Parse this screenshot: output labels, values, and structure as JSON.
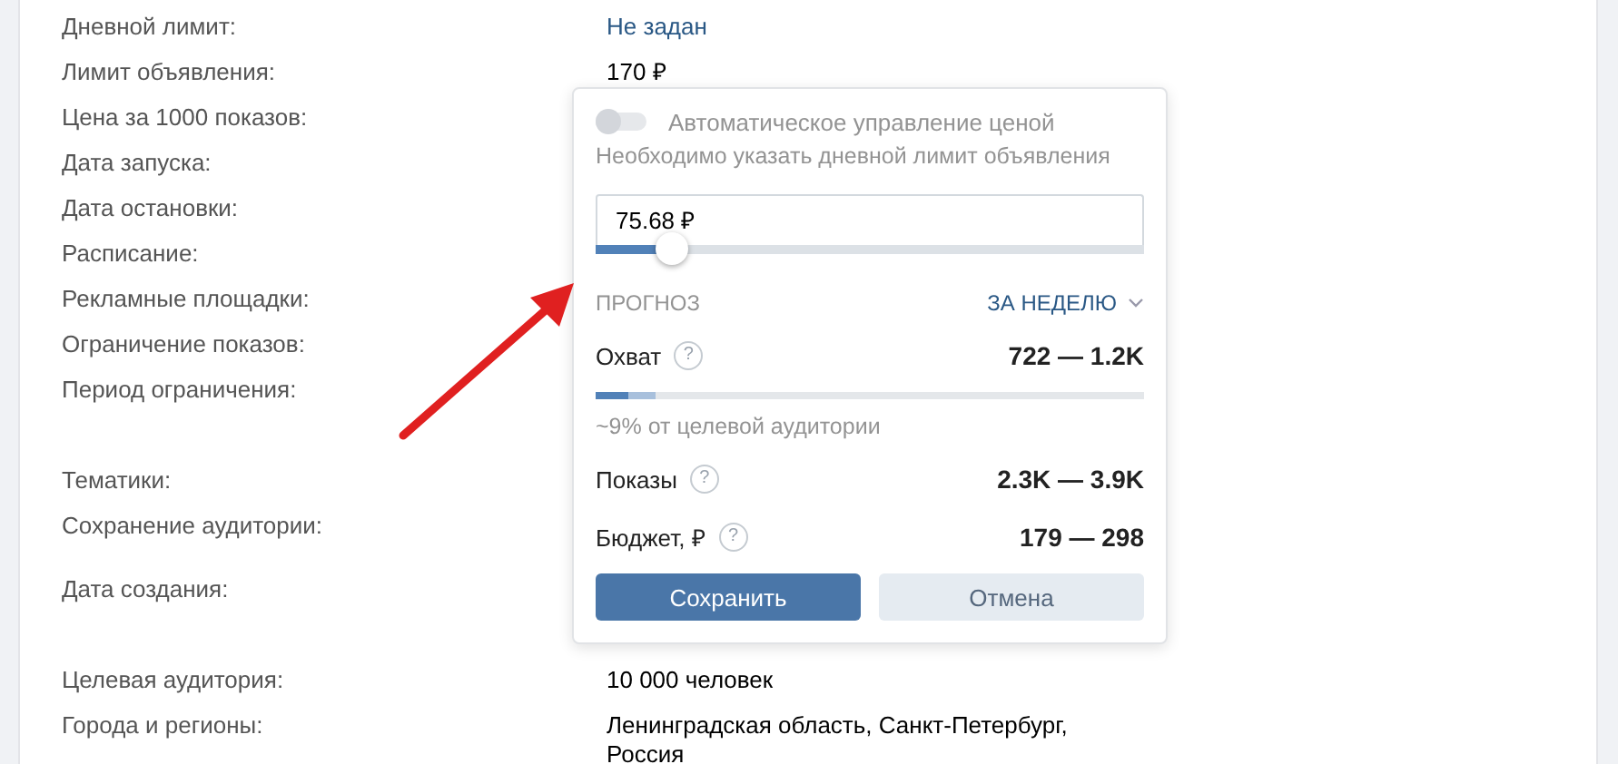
{
  "rows": [
    {
      "label": "Дневной лимит:",
      "value": "Не задан",
      "kind": "link"
    },
    {
      "label": "Лимит объявления:",
      "value": "170 ₽",
      "kind": "text"
    },
    {
      "label": "Цена за 1000 показов:"
    },
    {
      "label": "Дата запуска:"
    },
    {
      "label": "Дата остановки:"
    },
    {
      "label": "Расписание:"
    },
    {
      "label": "Рекламные площадки:"
    },
    {
      "label": "Ограничение показов:"
    },
    {
      "label": "Период ограничения:"
    },
    {
      "label": "Тематики:"
    },
    {
      "label": "Сохранение аудитории:"
    },
    {
      "label": "Дата создания:"
    },
    {
      "label": "Целевая аудитория:",
      "value": "10 000 человек",
      "kind": "text"
    },
    {
      "label": "Города и регионы:",
      "value": "Ленинградская область, Санкт-Петербург, Россия",
      "kind": "text"
    }
  ],
  "popover": {
    "auto_price": {
      "label": "Автоматическое управление ценой",
      "on": false,
      "disabled": true
    },
    "hint": "Необходимо указать дневной лимит объявления",
    "price": {
      "value": "75.68 ₽",
      "level": 0.14
    },
    "forecast_label": "ПРОГНОЗ",
    "period": "ЗА НЕДЕЛЮ",
    "reach": {
      "label": "Охват",
      "help": "?",
      "value": "722 — 1.2K",
      "bar": [
        {
          "level": 0.11
        },
        {
          "level": 0.06
        }
      ],
      "note": "~9% от целевой аудитории"
    },
    "metrics": [
      {
        "label": "Показы",
        "help": "?",
        "value": "2.3K — 3.9K"
      },
      {
        "label": "Бюджет, ₽",
        "help": "?",
        "value": "179 — 298"
      }
    ],
    "buttons": [
      {
        "label": "Сохранить",
        "kind": "primary"
      },
      {
        "label": "Отмена",
        "kind": "secondary"
      }
    ]
  }
}
